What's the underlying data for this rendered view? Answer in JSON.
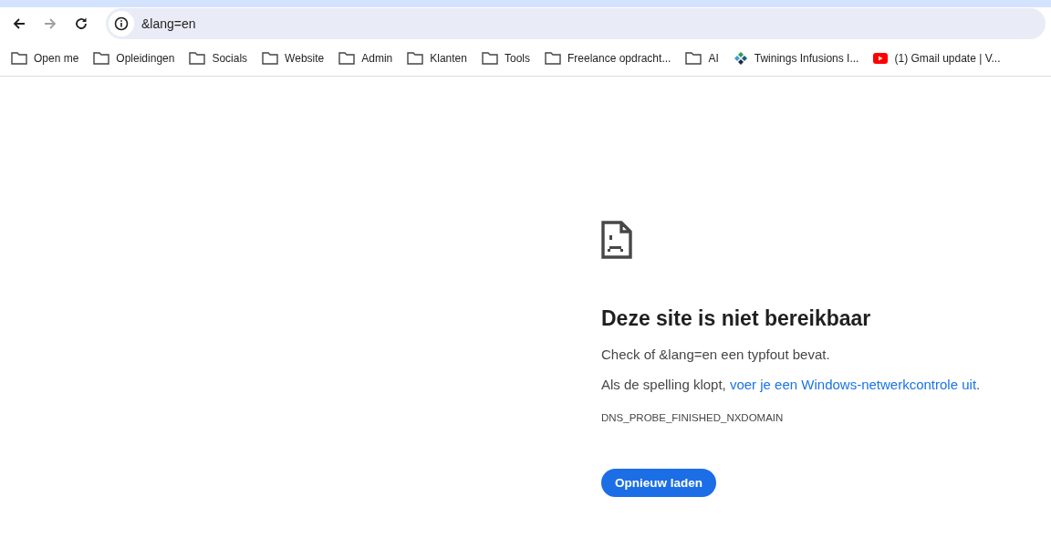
{
  "toolbar": {
    "nav_buttons": [
      {
        "kind": "back",
        "disabled": false
      },
      {
        "kind": "forward",
        "disabled": true
      },
      {
        "kind": "reload",
        "disabled": false
      }
    ],
    "address": {
      "value": "&lang=en"
    }
  },
  "bookmarks": [
    {
      "kind": "folder",
      "label": "Open me"
    },
    {
      "kind": "folder",
      "label": "Opleidingen"
    },
    {
      "kind": "folder",
      "label": "Socials"
    },
    {
      "kind": "folder",
      "label": "Website"
    },
    {
      "kind": "folder",
      "label": "Admin"
    },
    {
      "kind": "folder",
      "label": "Klanten"
    },
    {
      "kind": "folder",
      "label": "Tools"
    },
    {
      "kind": "folder",
      "label": "Freelance opdracht..."
    },
    {
      "kind": "folder",
      "label": "AI"
    },
    {
      "kind": "site",
      "label": "Twinings Infusions I..."
    },
    {
      "kind": "video",
      "label": "(1) Gmail update | V..."
    }
  ],
  "error": {
    "title": "Deze site is niet bereikbaar",
    "check": "Check of &lang=en een typfout bevat.",
    "suggestion": {
      "text": "Als de spelling klopt, ",
      "link": "voer je een Windows-netwerkcontrole uit",
      "end": "."
    },
    "code": "DNS_PROBE_FINISHED_NXDOMAIN",
    "button": "Opnieuw laden"
  }
}
